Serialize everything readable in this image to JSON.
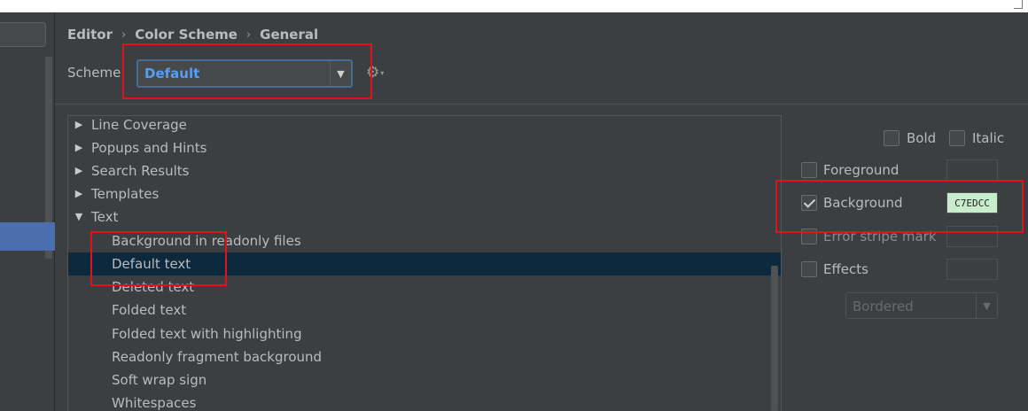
{
  "breadcrumb": [
    "Editor",
    "Color Scheme",
    "General"
  ],
  "breadcrumb_separator": "›",
  "scheme": {
    "label": "Scheme:",
    "value": "Default"
  },
  "tree": {
    "items": [
      {
        "label": "Line Coverage",
        "expander": "▶"
      },
      {
        "label": "Popups and Hints",
        "expander": "▶"
      },
      {
        "label": "Search Results",
        "expander": "▶"
      },
      {
        "label": "Templates",
        "expander": "▶"
      },
      {
        "label": "Text",
        "expander": "▼"
      },
      {
        "label": "Background in readonly files"
      },
      {
        "label": "Default text"
      },
      {
        "label": "Deleted text"
      },
      {
        "label": "Folded text"
      },
      {
        "label": "Folded text with highlighting"
      },
      {
        "label": "Readonly fragment background"
      },
      {
        "label": "Soft wrap sign"
      },
      {
        "label": "Whitespaces"
      }
    ],
    "selected": "Default text"
  },
  "attributes": {
    "bold": {
      "label": "Bold",
      "checked": false
    },
    "italic": {
      "label": "Italic",
      "checked": false
    },
    "foreground": {
      "label": "Foreground",
      "checked": false
    },
    "background": {
      "label": "Background",
      "checked": true,
      "color": "C7EDCC"
    },
    "error_stripe": {
      "label": "Error stripe mark",
      "checked": false
    },
    "effects": {
      "label": "Effects",
      "checked": false,
      "effect_type": "Bordered"
    }
  },
  "icons": {
    "combo_arrow": "▼",
    "gear": "⚙",
    "gear_dropdown": "▾"
  },
  "colors": {
    "selection": "#0d293e",
    "accent_blue": "#589df6",
    "highlight_red": "#e0121a",
    "background_swatch": "#c7edcc"
  }
}
